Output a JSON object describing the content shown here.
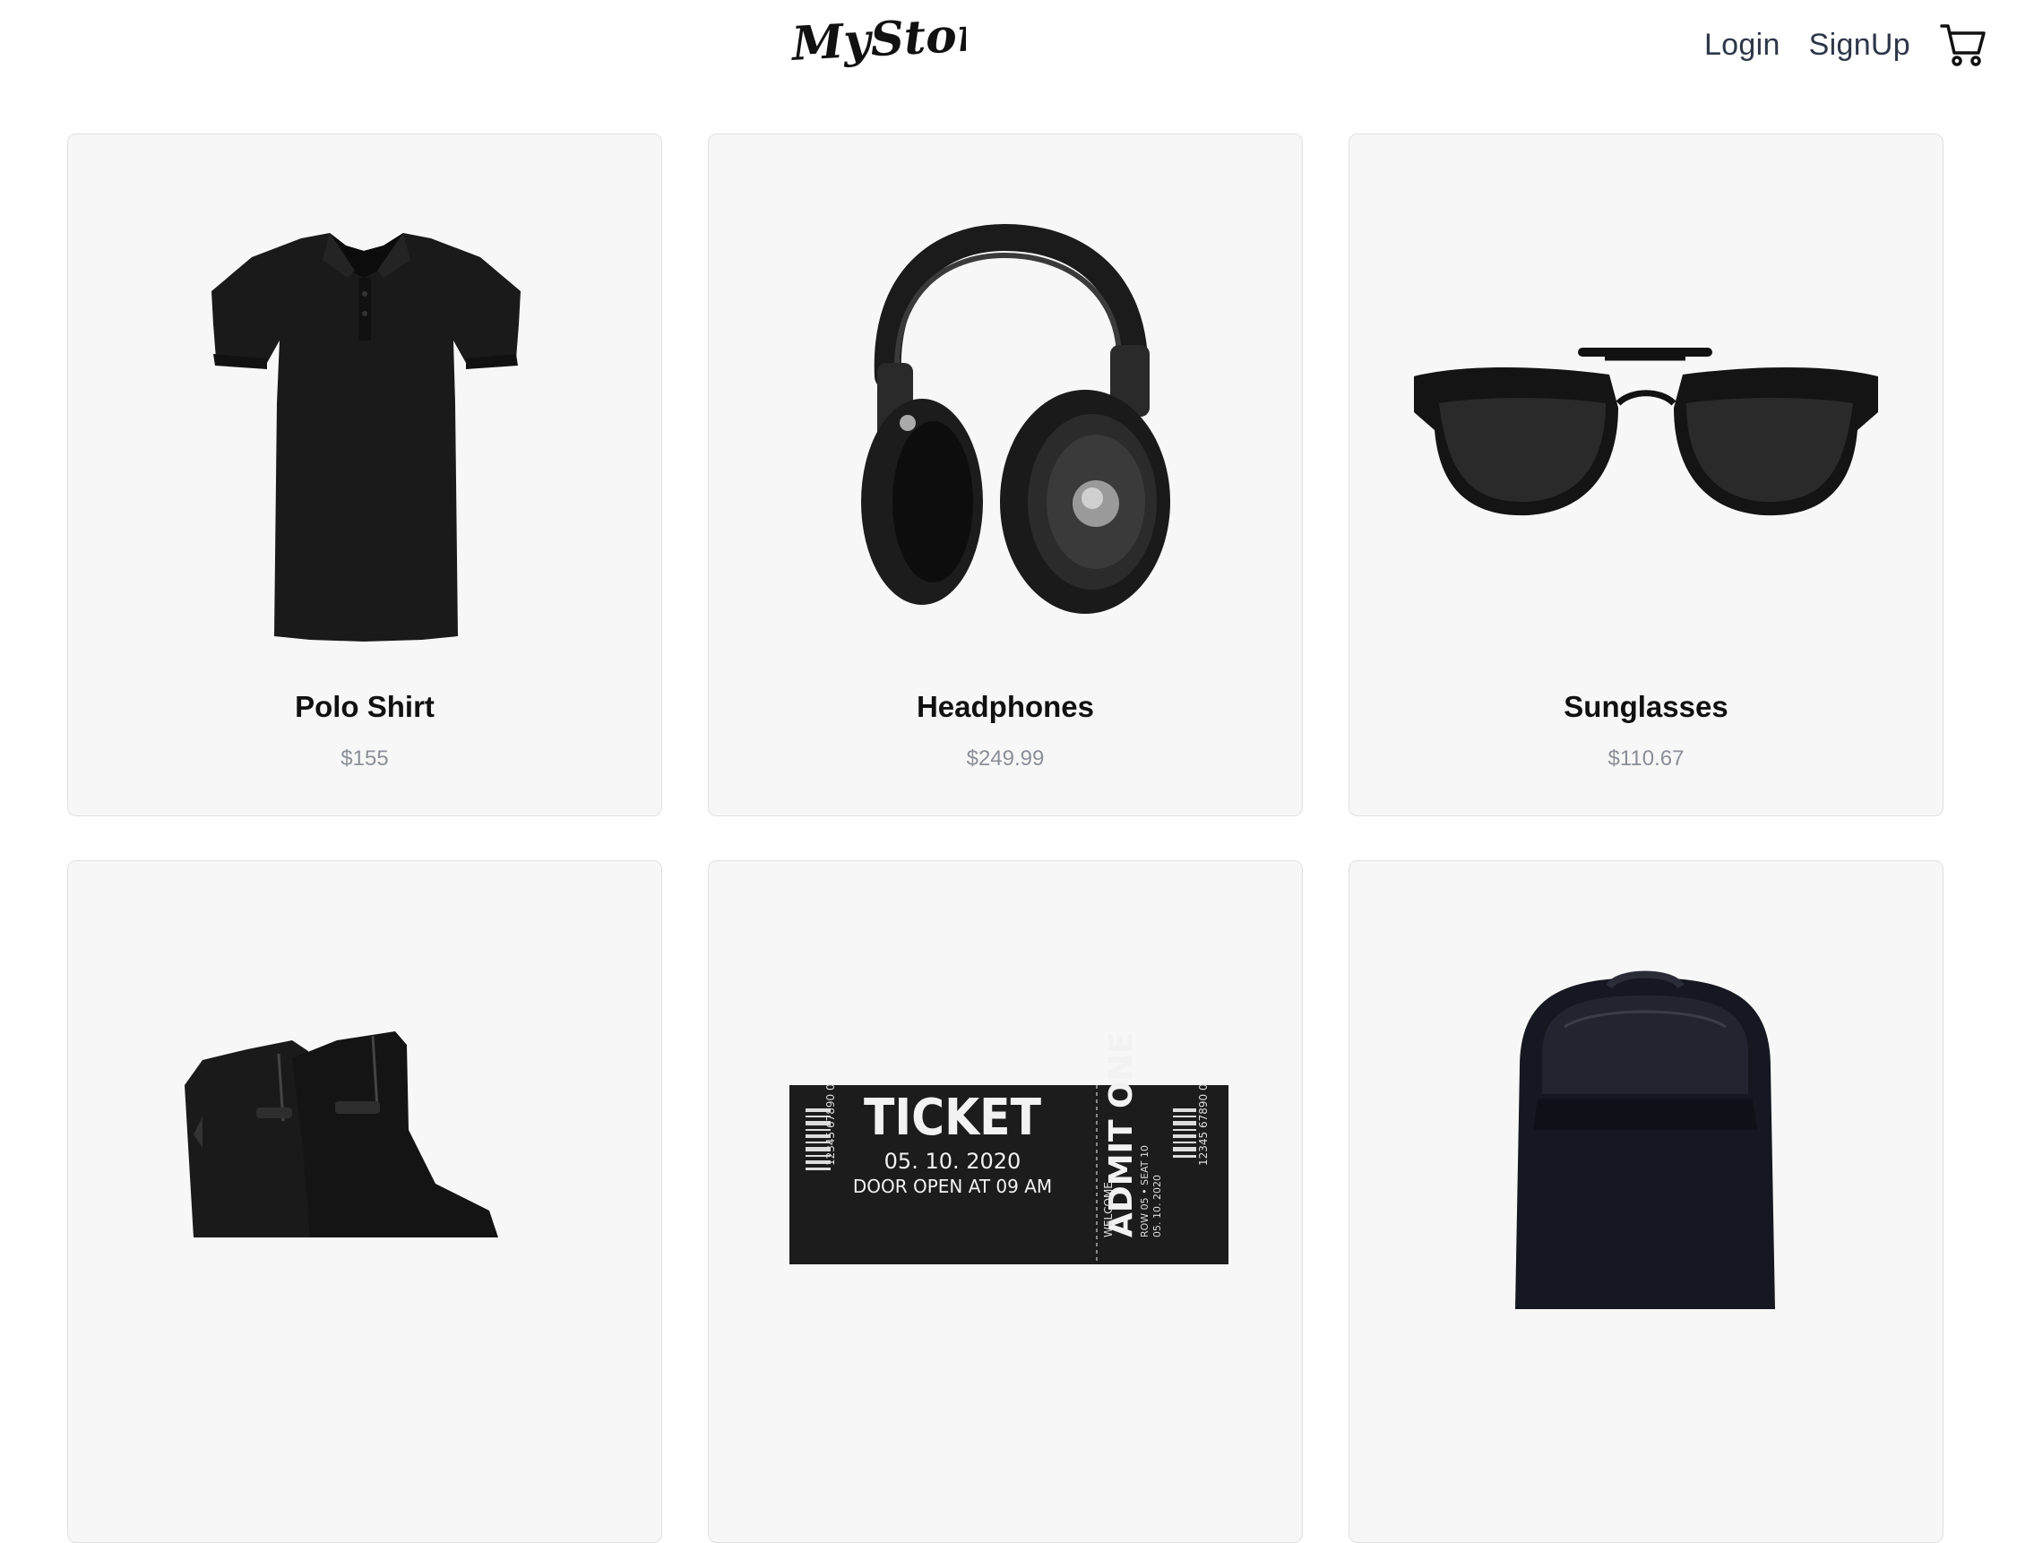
{
  "header": {
    "logo_text": "MyStore.",
    "nav": {
      "login_label": "Login",
      "signup_label": "SignUp"
    },
    "cart_icon": "shopping-cart-icon"
  },
  "products": [
    {
      "name": "Polo Shirt",
      "price": "$155",
      "image_icon": "polo-shirt-image"
    },
    {
      "name": "Headphones",
      "price": "$249.99",
      "image_icon": "headphones-image"
    },
    {
      "name": "Sunglasses",
      "price": "$110.67",
      "image_icon": "sunglasses-image"
    },
    {
      "name": "",
      "price": "",
      "image_icon": "boots-image"
    },
    {
      "name": "",
      "price": "",
      "image_icon": "ticket-image",
      "ticket": {
        "title": "TICKET",
        "date": "05. 10. 2020",
        "door": "DOOR OPEN AT 09 AM",
        "stub_main": "ADMIT ONE",
        "stub_welcome": "WELCOME",
        "stub_row": "ROW 05 • SEAT 10",
        "stub_date": "05. 10. 2020",
        "barcode_num": "12345 67890 0"
      }
    },
    {
      "name": "",
      "price": "",
      "image_icon": "backpack-image"
    }
  ],
  "colors": {
    "card_bg": "#f7f7f7",
    "card_border": "#e0e0e0",
    "nav_text": "#2d3748",
    "price_text": "#8a8f98"
  }
}
